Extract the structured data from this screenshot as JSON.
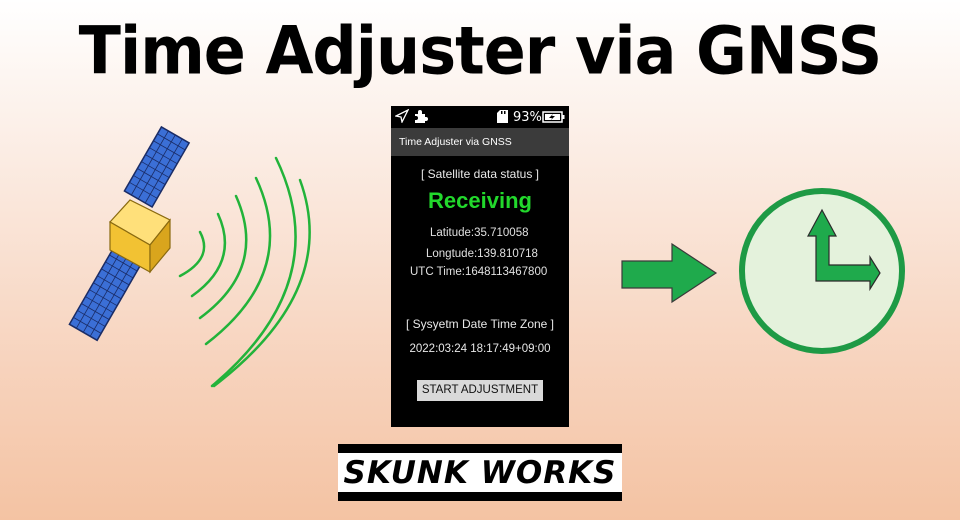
{
  "headline": "Time Adjuster via GNSS",
  "phone": {
    "status_bar": {
      "battery_percent": "93%",
      "icons": [
        "navigation-arrow-icon",
        "puzzle-extension-icon",
        "sd-card-icon",
        "battery-charging-icon"
      ]
    },
    "app_title": "Time Adjuster via GNSS",
    "satellite_section_title": "[ Satellite data status ]",
    "satellite_status": "Receiving",
    "latitude_label": "Latitude:",
    "latitude_value": "35.710058",
    "longitude_label": "Longtude:",
    "longitude_value": "139.810718",
    "utc_label": "UTC Time:",
    "utc_value": "1648113467800",
    "system_section_title": "[ Sysyetm Date Time Zone ]",
    "system_datetime": "2022:03:24 18:17:49+09:00",
    "start_button_label": "START ADJUSTMENT"
  },
  "brand_text": "SKUNK WORKS",
  "colors": {
    "receiving_green": "#22d82c",
    "arrow_green": "#1faa4c",
    "clock_face": "#e4f2dc",
    "clock_rim": "#1e9a45",
    "signal_wave": "#22b33a",
    "satellite_panel": "#3b6fd6",
    "satellite_body": "#f2c233"
  }
}
